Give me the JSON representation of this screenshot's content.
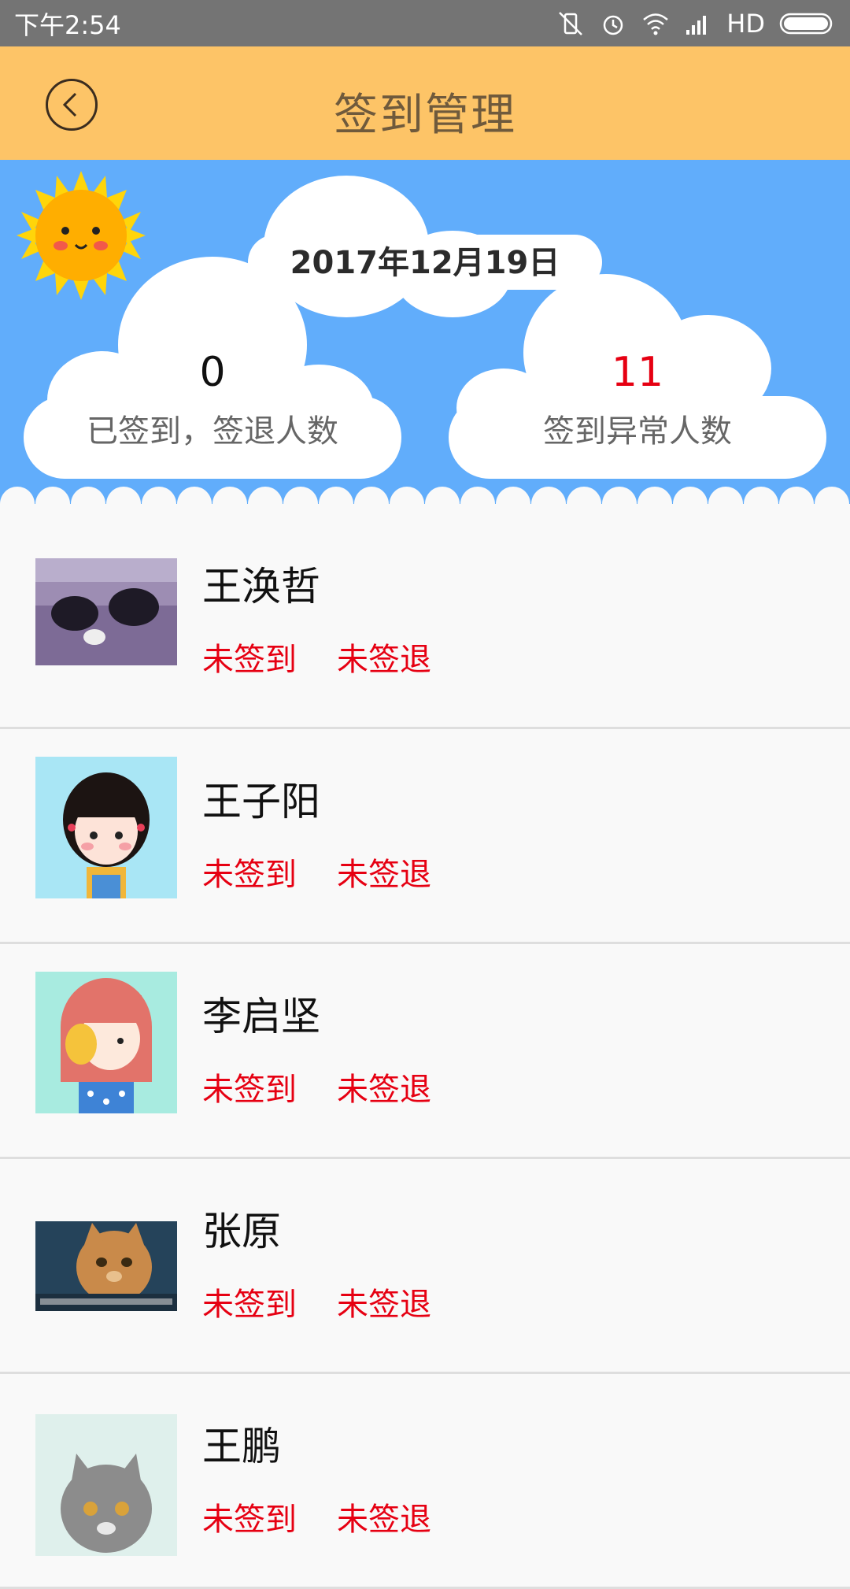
{
  "status_bar": {
    "time": "下午2:54",
    "network": "HD",
    "icons": [
      "mute-vibrate-icon",
      "alarm-icon",
      "wifi-icon",
      "signal-icon",
      "battery-icon"
    ]
  },
  "header": {
    "title": "签到管理",
    "back_icon": "chevron-left-icon",
    "background": "#fdc467"
  },
  "banner": {
    "date": "2017年12月19日",
    "background": "#61adfb",
    "stats": {
      "signed_count": "0",
      "signed_label": "已签到，签退人数",
      "abnormal_count": "11",
      "abnormal_label": "签到异常人数",
      "abnormal_color": "#e60012"
    }
  },
  "list": {
    "items": [
      {
        "name": "王涣哲",
        "sign_in": "未签到",
        "sign_out": "未签退",
        "avatar": "cat-avatar-dark"
      },
      {
        "name": "王子阳",
        "sign_in": "未签到",
        "sign_out": "未签退",
        "avatar": "girl-cartoon-avatar"
      },
      {
        "name": "李启坚",
        "sign_in": "未签到",
        "sign_out": "未签退",
        "avatar": "girl-pink-hair-avatar"
      },
      {
        "name": "张原",
        "sign_in": "未签到",
        "sign_out": "未签退",
        "avatar": "cat-orange-avatar"
      },
      {
        "name": "王鹏",
        "sign_in": "未签到",
        "sign_out": "未签退",
        "avatar": "cat-grey-avatar"
      }
    ]
  }
}
